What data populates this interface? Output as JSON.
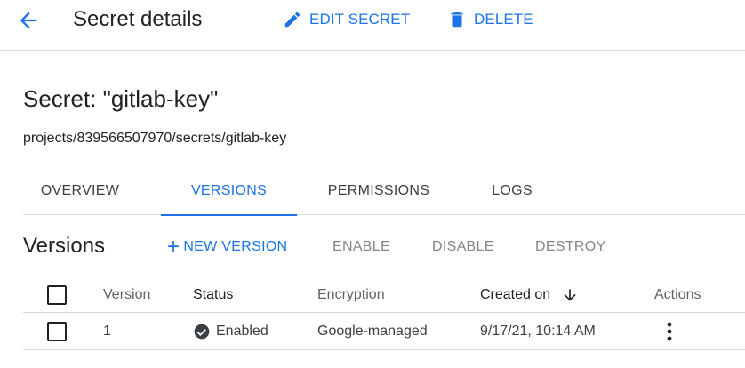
{
  "header": {
    "title": "Secret details",
    "edit_label": "EDIT SECRET",
    "delete_label": "DELETE",
    "back_icon": "arrow-back-icon",
    "edit_icon": "pencil-icon",
    "delete_icon": "trash-icon"
  },
  "secret": {
    "heading": "Secret: \"gitlab-key\"",
    "path": "projects/839566507970/secrets/gitlab-key"
  },
  "tabs": [
    {
      "label": "OVERVIEW",
      "active": false
    },
    {
      "label": "VERSIONS",
      "active": true
    },
    {
      "label": "PERMISSIONS",
      "active": false
    },
    {
      "label": "LOGS",
      "active": false
    }
  ],
  "versions": {
    "title": "Versions",
    "actions": {
      "new_version_icon": "+",
      "new_version": "NEW VERSION",
      "enable": "ENABLE",
      "disable": "DISABLE",
      "destroy": "DESTROY"
    },
    "columns": {
      "version": "Version",
      "status": "Status",
      "encryption": "Encryption",
      "created_on": "Created on",
      "actions": "Actions"
    },
    "rows": [
      {
        "version": "1",
        "status": "Enabled",
        "encryption": "Google-managed",
        "created_on": "9/17/21, 10:14 AM"
      }
    ]
  },
  "colors": {
    "accent": "#1a73e8",
    "disabled": "#80868b",
    "divider": "#dadce0",
    "enabled_status": "#3c4043"
  }
}
